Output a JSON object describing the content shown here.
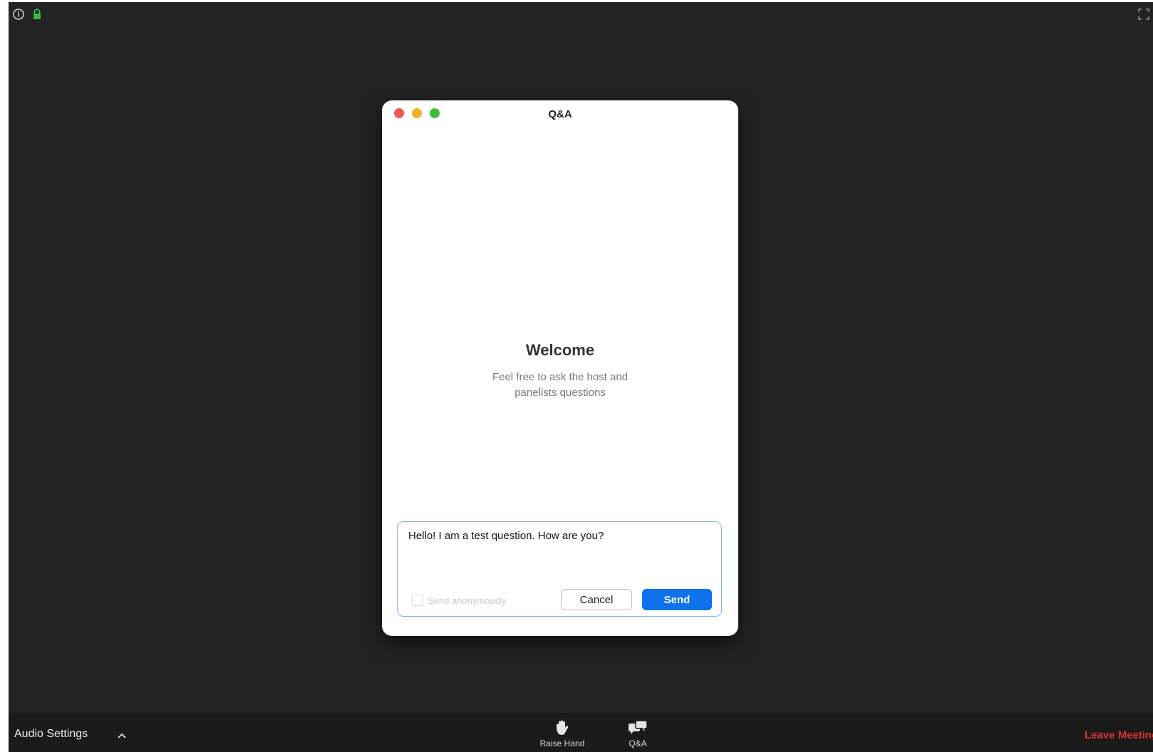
{
  "top_bar": {
    "icons": [
      "info-icon",
      "lock-icon",
      "fullscreen-icon"
    ],
    "lock_color": "#2fbf3f"
  },
  "qa_window": {
    "title": "Q&A",
    "welcome_title": "Welcome",
    "welcome_subtitle": "Feel free to ask the host and panelists questions",
    "input_value": "Hello! I am a test question. How are you?",
    "anonymous_label": "Send anonymously",
    "anonymous_checked": false,
    "cancel_label": "Cancel",
    "send_label": "Send",
    "accent_color": "#0e72ed"
  },
  "toolbar": {
    "audio_settings_label": "Audio Settings",
    "raise_hand_label": "Raise Hand",
    "qa_label": "Q&A",
    "leave_label": "Leave Meeting",
    "leave_color": "#e0322c"
  }
}
